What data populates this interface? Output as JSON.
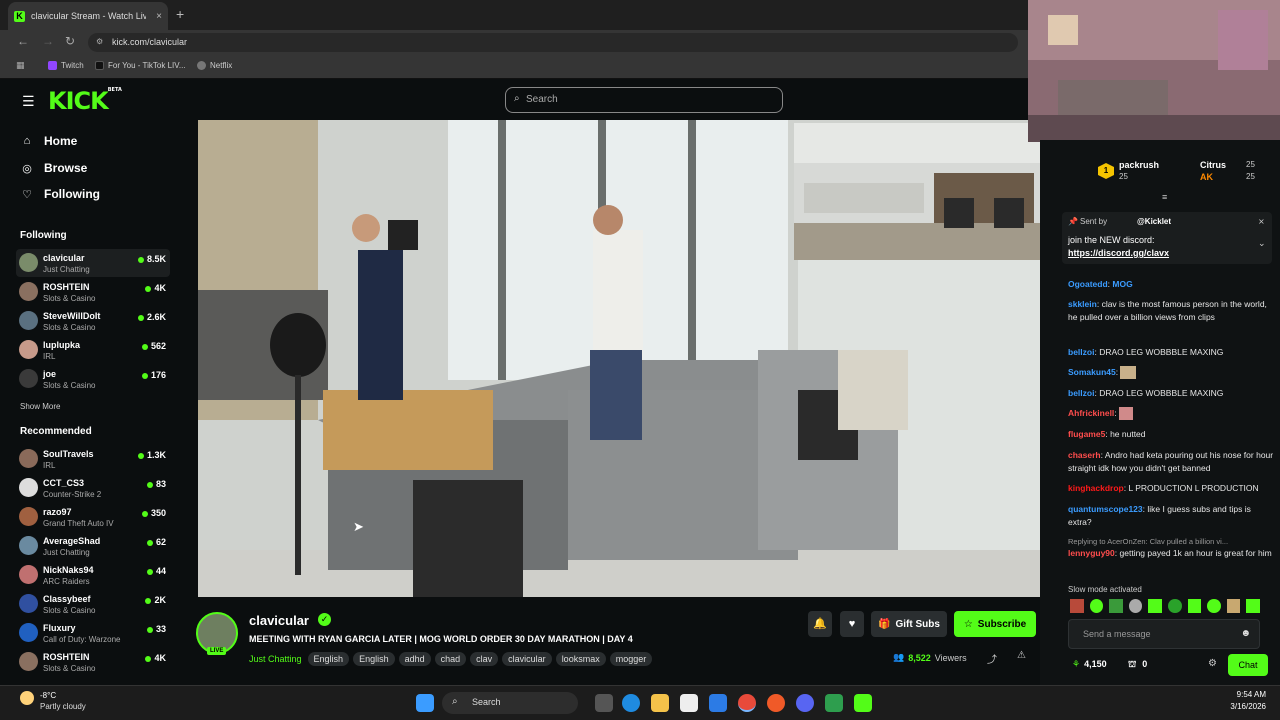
{
  "browser": {
    "tab_title": "clavicular Stream - Watch Live on Kick",
    "tab_close": "×",
    "new_tab": "+",
    "url": "kick.com/clavicular",
    "bookmarks": [
      "Twitch",
      "For You - TikTok LIV...",
      "Netflix"
    ]
  },
  "kick": {
    "logo": "KICK",
    "logo_beta": "BETA",
    "search_placeholder": "Search",
    "nav": [
      {
        "label": "Home",
        "icon": "home-icon"
      },
      {
        "label": "Browse",
        "icon": "compass-icon"
      },
      {
        "label": "Following",
        "icon": "heart-icon"
      }
    ],
    "following_title": "Following",
    "following": [
      {
        "name": "clavicular",
        "category": "Just Chatting",
        "viewers": "8.5K"
      },
      {
        "name": "ROSHTEIN",
        "category": "Slots & Casino",
        "viewers": "4K"
      },
      {
        "name": "SteveWillDoIt",
        "category": "Slots & Casino",
        "viewers": "2.6K"
      },
      {
        "name": "luplupka",
        "category": "IRL",
        "viewers": "562"
      },
      {
        "name": "joe",
        "category": "Slots & Casino",
        "viewers": "176"
      }
    ],
    "show_more": "Show More",
    "recommended_title": "Recommended",
    "recommended": [
      {
        "name": "SoulTravels",
        "category": "IRL",
        "viewers": "1.3K"
      },
      {
        "name": "CCT_CS3",
        "category": "Counter-Strike 2",
        "viewers": "83"
      },
      {
        "name": "razo97",
        "category": "Grand Theft Auto IV",
        "viewers": "350"
      },
      {
        "name": "AverageShad",
        "category": "Just Chatting",
        "viewers": "62"
      },
      {
        "name": "NickNaks94",
        "category": "ARC Raiders",
        "viewers": "44"
      },
      {
        "name": "Classybeef",
        "category": "Slots & Casino",
        "viewers": "2K"
      },
      {
        "name": "Fluxury",
        "category": "Call of Duty: Warzone",
        "viewers": "33"
      },
      {
        "name": "ROSHTEIN",
        "category": "Slots & Casino",
        "viewers": "4K"
      }
    ]
  },
  "stream": {
    "streamer": "clavicular",
    "live_badge": "LIVE",
    "title": "MEETING WITH RYAN GARCIA LATER | MOG WORLD ORDER 30 DAY MARATHON | DAY 4",
    "category": "Just Chatting",
    "tags": [
      "English",
      "English",
      "adhd",
      "chad",
      "clav",
      "clavicular",
      "looksmax",
      "mogger"
    ],
    "viewers": "8,522",
    "viewers_label": "Viewers",
    "gift_label": "Gift Subs",
    "subscribe_label": "Subscribe"
  },
  "chat": {
    "leaders": [
      {
        "name": "packrush",
        "amount": "25"
      },
      {
        "name": "Citrus",
        "amount": "25"
      },
      {
        "name": "AK",
        "amount": "25"
      }
    ],
    "pinned_by_label": "Sent by",
    "pinned_by": "@Kicklet",
    "pinned_text": "join the NEW discord:",
    "pinned_link": "https://discord.gg/clavx",
    "messages": [
      {
        "user": "Ogoatedd",
        "text": "MOG",
        "color": "#3b9cff"
      },
      {
        "user": "skklein",
        "text": "clav is the most famous person in the world, he pulled over a billion views from clips",
        "color": "#3b9cff"
      },
      {
        "user": "bellzoi",
        "text": "DRAO LEG WOBBBLE MAXING",
        "color": "#3b9cff"
      },
      {
        "user": "Somakun45",
        "text": "",
        "color": "#3b9cff"
      },
      {
        "user": "bellzoi",
        "text": "DRAO LEG WOBBBLE MAXING",
        "color": "#3b9cff"
      },
      {
        "user": "Ahfrickinell",
        "text": "",
        "color": "#ff4d4d"
      },
      {
        "user": "flugame5",
        "text": "he nutted",
        "color": "#ff4d4d"
      },
      {
        "user": "chaserh",
        "text": "Andro had keta pouring out his nose for hour straight idk how you didn't get banned",
        "color": "#ff4d4d"
      },
      {
        "user": "kinghackdrop",
        "text": "L PRODUCTION L PRODUCTION",
        "color": "#ff1a1a"
      },
      {
        "user": "quantumscope123",
        "text": "like I guess subs and tips is extra?",
        "color": "#3b9cff"
      }
    ],
    "reply_context": "Replying to AcerOnZen: Clav pulled a billion vi...",
    "reply_user": "lennyguy90",
    "reply_text": "getting payed 1k an hour is great for him",
    "slow_mode": "Slow mode activated",
    "input_placeholder": "Send a message",
    "points": "4,150",
    "gifts": "0",
    "chat_button": "Chat"
  },
  "taskbar": {
    "weather_temp": "-8°C",
    "weather_desc": "Partly cloudy",
    "search": "Search",
    "time": "9:54 AM",
    "date": "3/16/2026"
  }
}
